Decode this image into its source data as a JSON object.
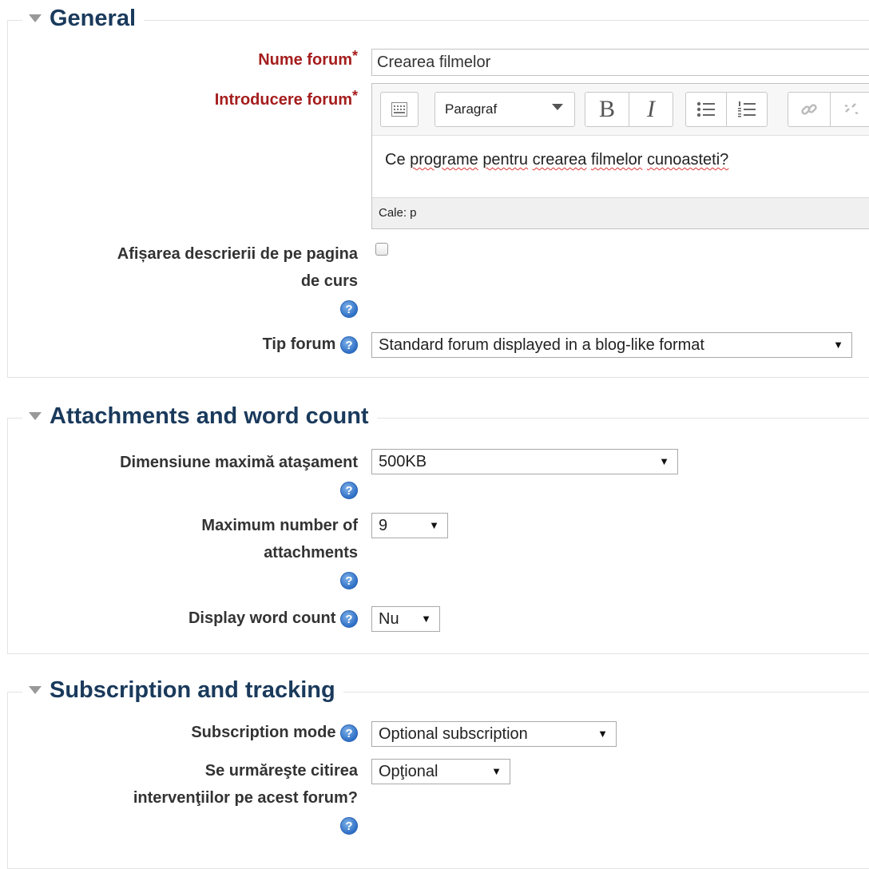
{
  "general": {
    "legend": "General",
    "forum_name_label": "Nume forum",
    "forum_name_value": "Crearea filmelor",
    "forum_intro_label": "Introducere forum",
    "required_marker": "*",
    "editor": {
      "format_value": "Paragraf",
      "bold": "B",
      "italic": "I",
      "content_words": [
        "Ce",
        "programe",
        "pentru",
        "crearea",
        "filmelor",
        "cunoasteti?"
      ],
      "path_text": "Cale: p"
    },
    "show_description_label_line1": "Afișarea descrierii de pe pagina",
    "show_description_label_line2": "de curs",
    "forum_type_label": "Tip forum",
    "forum_type_value": "Standard forum displayed in a blog-like format"
  },
  "attachments": {
    "legend": "Attachments and word count",
    "max_size_label": "Dimensiune maximă ataşament",
    "max_size_value": "500KB",
    "max_number_label_line1": "Maximum number of",
    "max_number_label_line2": "attachments",
    "max_number_value": "9",
    "word_count_label": "Display word count",
    "word_count_value": "Nu"
  },
  "subscription": {
    "legend": "Subscription and tracking",
    "mode_label": "Subscription mode",
    "mode_value": "Optional subscription",
    "tracking_label_line1": "Se urmăreşte citirea",
    "tracking_label_line2": "intervenţiilor pe acest forum?",
    "tracking_value": "Opţional"
  },
  "icons": {
    "help": "?",
    "dropdown": "▼"
  }
}
